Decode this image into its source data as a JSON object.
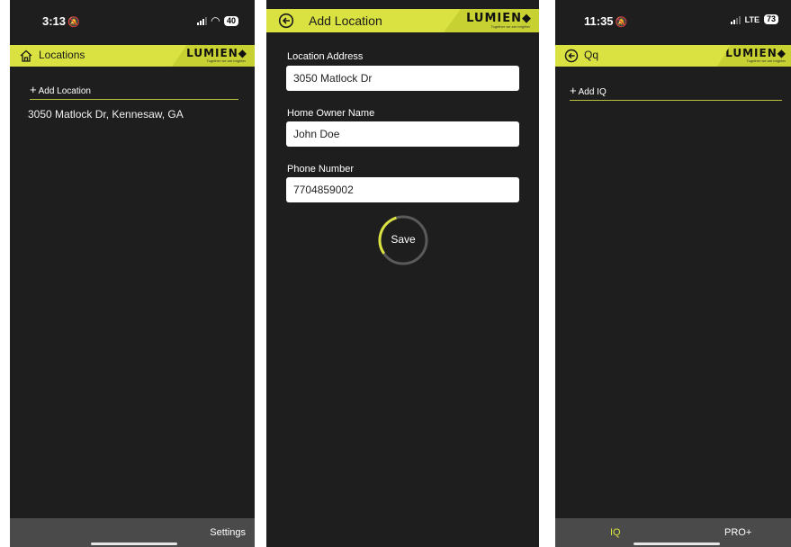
{
  "screen1": {
    "status": {
      "time": "3:13",
      "battery": "40"
    },
    "appbar": {
      "title": "Locations",
      "logo": "LUMIEN◆",
      "tagline": "Together we are brighter",
      "lead_icon": "home-icon"
    },
    "add_label": "Add Location",
    "items": [
      "3050 Matlock Dr, Kennesaw, GA"
    ],
    "bottom": {
      "settings": "Settings"
    }
  },
  "screen2": {
    "appbar": {
      "title": "Add Location",
      "logo": "LUMIEN◆",
      "tagline": "Together we are brighter",
      "lead_icon": "back-arrow-icon"
    },
    "fields": [
      {
        "label": "Location Address",
        "value": "3050 Matlock Dr"
      },
      {
        "label": "Home Owner Name",
        "value": "John Doe"
      },
      {
        "label": "Phone Number",
        "value": "7704859002"
      }
    ],
    "save_label": "Save",
    "save_progress": 0.3
  },
  "screen3": {
    "status": {
      "time": "11:35",
      "network": "LTE",
      "battery": "73"
    },
    "appbar": {
      "title": "Qq",
      "logo": "LUMIEN◆",
      "tagline": "Together we are brighter",
      "lead_icon": "back-arrow-icon"
    },
    "add_label": "Add IQ",
    "bottom": {
      "tab_iq": "IQ",
      "tab_pro": "PRO+"
    }
  },
  "colors": {
    "accent": "#d9e241",
    "background": "#1e1e1e",
    "bottom_bar": "#4a4a4a"
  }
}
